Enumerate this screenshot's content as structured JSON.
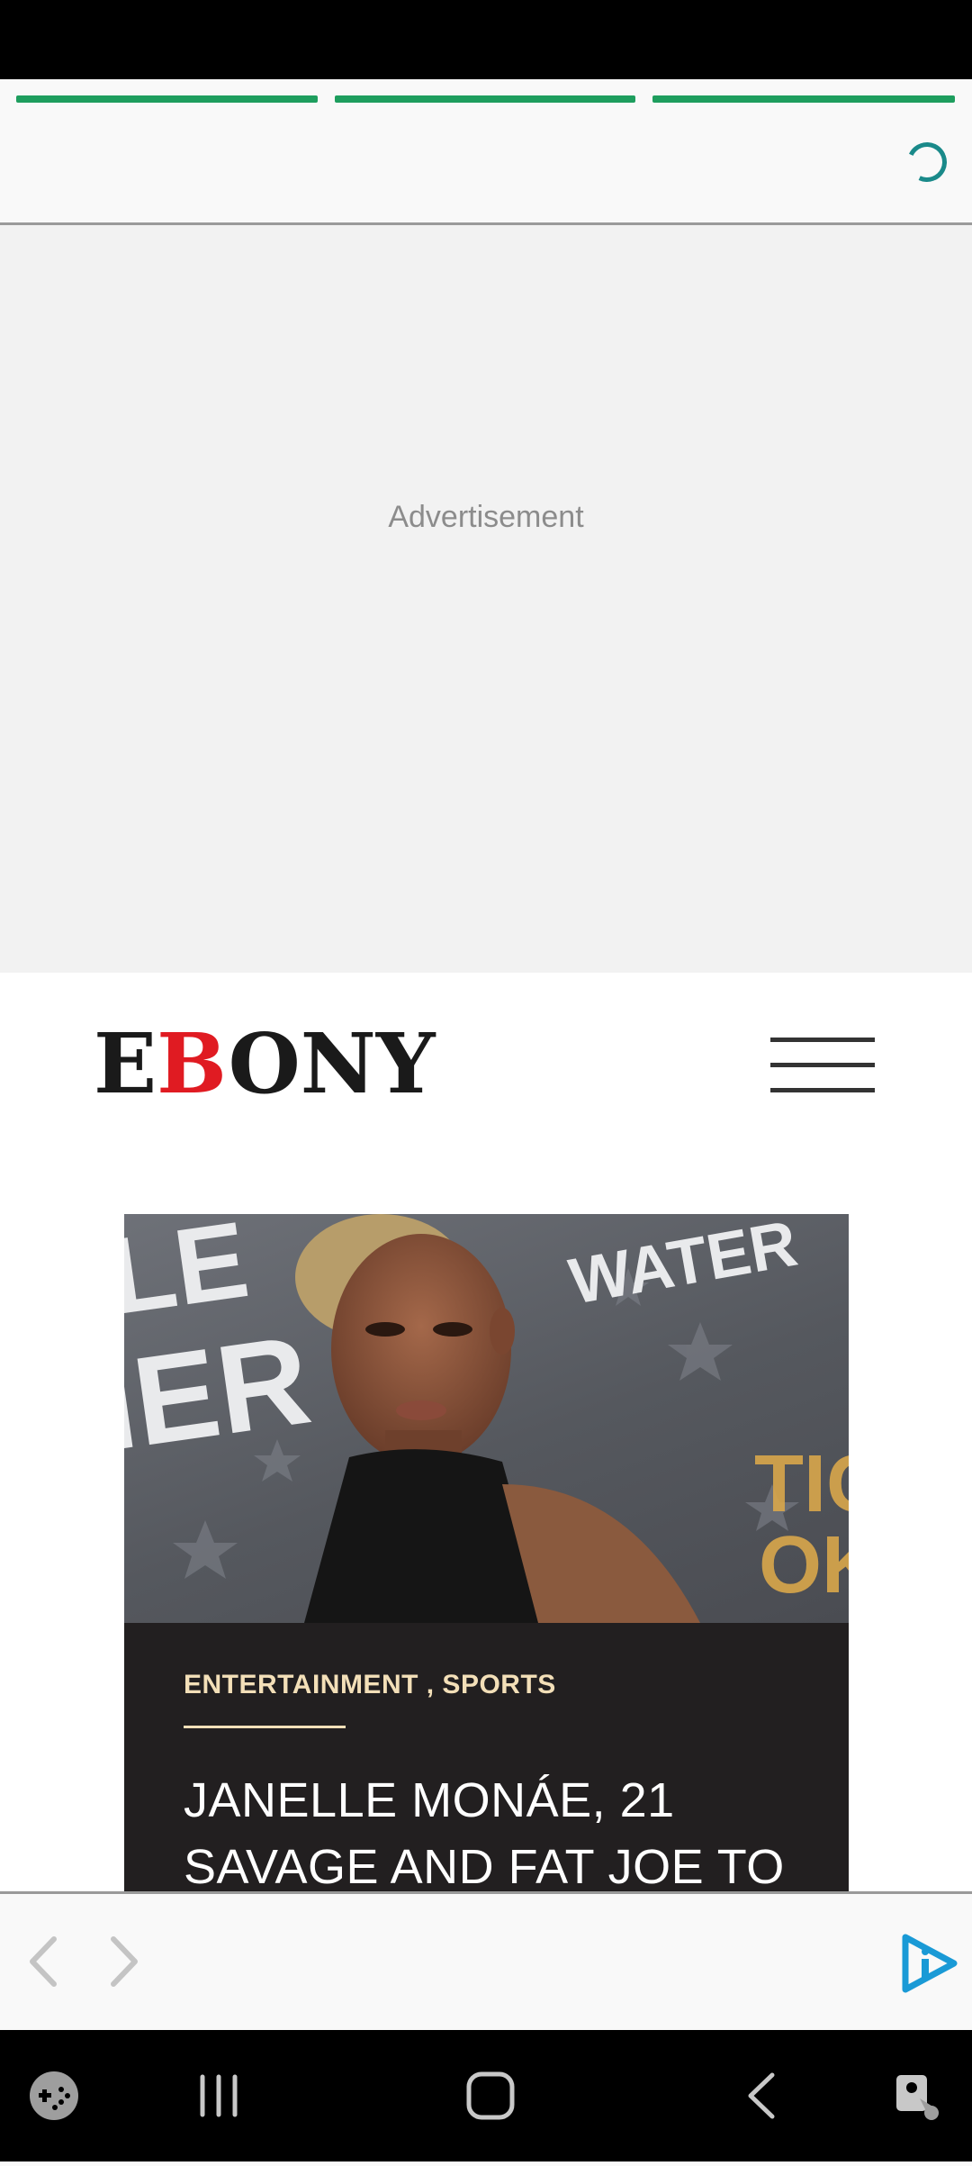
{
  "progress": {
    "segments": [
      {
        "state": "complete"
      },
      {
        "state": "complete"
      },
      {
        "state": "complete"
      }
    ],
    "accent": "#1e9e5e",
    "loading_icon": "loading-spinner-icon"
  },
  "ad": {
    "label": "Advertisement"
  },
  "site": {
    "logo_prefix": "E",
    "logo_accent": "B",
    "logo_suffix": "ONY",
    "logo_accent_color": "#e01b22",
    "menu_icon": "hamburger-menu-icon"
  },
  "article": {
    "categories": "ENTERTAINMENT , SPORTS",
    "headline": "JANELLE MONÁE, 21 SAVAGE AND FAT JOE TO",
    "image_backdrop_words": [
      "LE",
      "IER",
      "WATER"
    ]
  },
  "browser": {
    "back_icon": "chevron-left-icon",
    "forward_icon": "chevron-right-icon",
    "brand_icon": "play-info-icon"
  },
  "system_nav": {
    "items": [
      "game-launcher-icon",
      "recent-apps-icon",
      "home-icon",
      "back-icon",
      "accessibility-icon"
    ]
  }
}
